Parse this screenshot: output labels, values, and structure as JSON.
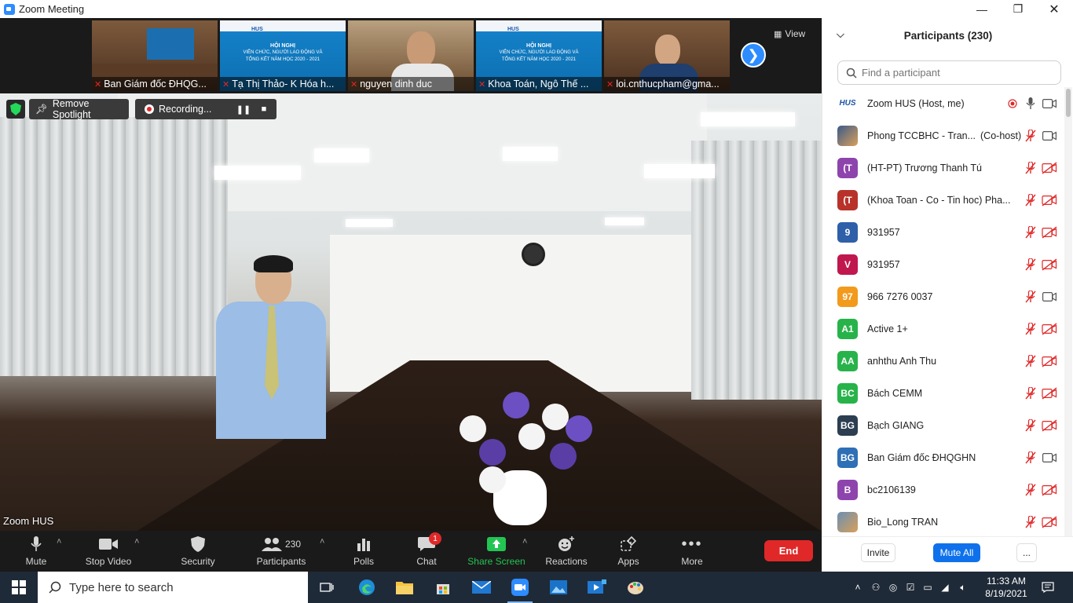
{
  "window": {
    "title": "Zoom Meeting"
  },
  "thumbnails": [
    {
      "name": "Ban Giám đốc ĐHQG..."
    },
    {
      "name": "Tạ Thị Thảo- K Hóa h..."
    },
    {
      "name": "nguyen dinh duc"
    },
    {
      "name": "Khoa Toán, Ngô Thế ..."
    },
    {
      "name": "loi.cnthucpham@gma..."
    }
  ],
  "slide": {
    "org": "HUS",
    "title": "HỘI NGHỊ",
    "line1": "VIÊN CHỨC, NGƯỜI LAO ĐỘNG VÀ",
    "line2": "TỔNG KẾT NĂM HỌC 2020 - 2021"
  },
  "view_label": "View",
  "spotlight": {
    "remove_label": "Remove Spotlight",
    "recording_label": "Recording..."
  },
  "active_speaker": "Zoom HUS",
  "toolbar": {
    "mute": "Mute",
    "stop_video": "Stop Video",
    "security": "Security",
    "participants": "Participants",
    "participants_count": "230",
    "polls": "Polls",
    "chat": "Chat",
    "chat_badge": "1",
    "share_screen": "Share Screen",
    "reactions": "Reactions",
    "apps": "Apps",
    "more": "More",
    "end": "End"
  },
  "panel": {
    "title": "Participants (230)",
    "search_placeholder": "Find a participant",
    "participants": [
      {
        "avatar": "HUS",
        "color": "#ffffff",
        "name": "Zoom HUS (Host, me)",
        "mic": "on",
        "video": "on",
        "recording": true
      },
      {
        "avatar": "",
        "color": "#3b5a8a",
        "name": "Phong TCCBHC - Tran...",
        "role": "(Co-host)",
        "mic": "muted",
        "video": "on"
      },
      {
        "avatar": "(T",
        "color": "#8e44ad",
        "name": "(HT-PT) Trương Thanh Tú",
        "mic": "muted",
        "video": "off"
      },
      {
        "avatar": "(T",
        "color": "#b8322a",
        "name": "(Khoa Toan - Co - Tin hoc) Pha...",
        "mic": "muted",
        "video": "off"
      },
      {
        "avatar": "9",
        "color": "#2e5fa8",
        "name": "931957",
        "mic": "muted",
        "video": "off"
      },
      {
        "avatar": "V",
        "color": "#c0174f",
        "name": "931957",
        "mic": "muted",
        "video": "off"
      },
      {
        "avatar": "97",
        "color": "#f29a1c",
        "name": "966 7276 0037",
        "mic": "muted",
        "video": "on"
      },
      {
        "avatar": "A1",
        "color": "#27b34a",
        "name": "Active 1+",
        "mic": "muted",
        "video": "off"
      },
      {
        "avatar": "AA",
        "color": "#27b34a",
        "name": "anhthu Anh Thu",
        "mic": "muted",
        "video": "off"
      },
      {
        "avatar": "BC",
        "color": "#27b34a",
        "name": "Bách CEMM",
        "mic": "muted",
        "video": "off"
      },
      {
        "avatar": "BG",
        "color": "#2c3e50",
        "name": "Bạch GIANG",
        "mic": "muted",
        "video": "off"
      },
      {
        "avatar": "BG",
        "color": "#2e6fb5",
        "name": "Ban Giám đốc ĐHQGHN",
        "mic": "muted",
        "video": "on"
      },
      {
        "avatar": "B",
        "color": "#8e44ad",
        "name": "bc2106139",
        "mic": "muted",
        "video": "off"
      },
      {
        "avatar": "",
        "color": "#6b8fb3",
        "name": "Bio_Long TRAN",
        "mic": "muted",
        "video": "off"
      }
    ],
    "invite": "Invite",
    "mute_all": "Mute All",
    "more": "..."
  },
  "taskbar": {
    "search_placeholder": "Type here to search",
    "time": "11:33 AM",
    "date": "8/19/2021"
  }
}
